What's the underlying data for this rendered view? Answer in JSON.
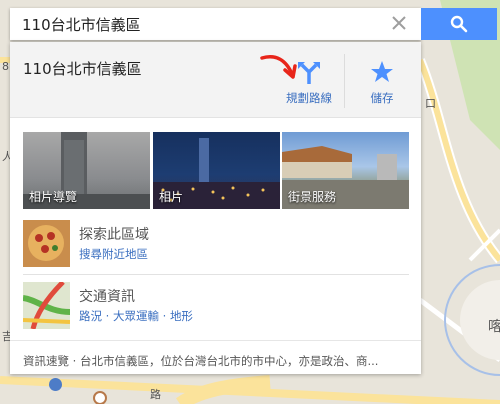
{
  "search": {
    "value": "110台北市信義區",
    "clear_glyph": "✕"
  },
  "place": {
    "title": "110台北市信義區"
  },
  "actions": {
    "directions_label": "規劃路線",
    "save_label": "儲存"
  },
  "photos": [
    {
      "label": "相片導覽"
    },
    {
      "label": "相片"
    },
    {
      "label": "街景服務"
    }
  ],
  "explore": {
    "title": "探索此區域",
    "link": "搜尋附近地區"
  },
  "traffic": {
    "title": "交通資訊",
    "links": [
      "路況",
      "大眾運輸",
      "地形"
    ],
    "separator": " · "
  },
  "footer": {
    "text": "資訊速覽 · 台北市信義區，位於台灣台北市的市中心，亦是政治、商..."
  },
  "map": {
    "labels": [
      "8",
      "人",
      "吉",
      "口",
      "喀",
      "路"
    ]
  },
  "colors": {
    "accent": "#4d90fe",
    "link": "#3b6fc0",
    "arrow": "#e8251a"
  }
}
